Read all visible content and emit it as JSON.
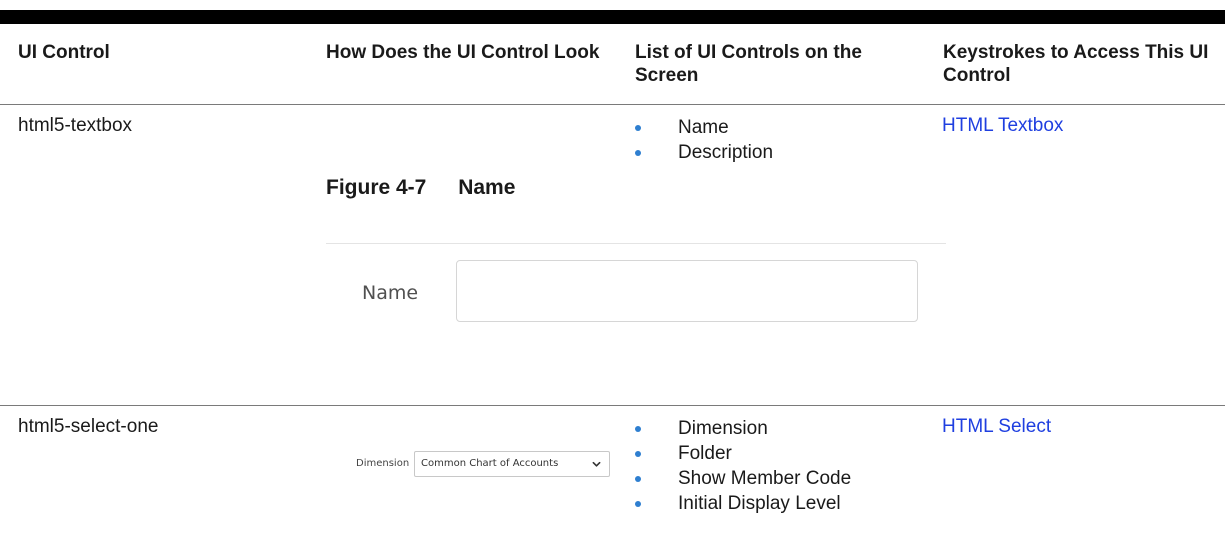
{
  "table": {
    "headers": [
      "UI Control",
      "How Does the UI Control Look",
      "List of UI Controls on the Screen",
      "Keystrokes to Access This UI Control"
    ],
    "rows": [
      {
        "control": "html5-textbox",
        "figure_number": "Figure 4-7",
        "figure_title": "Name",
        "mock_label": "Name",
        "mock_input_value": "",
        "list": [
          "Name",
          "Description"
        ],
        "keystroke_link": "HTML Textbox"
      },
      {
        "control": "html5-select-one",
        "mock_label": "Dimension",
        "mock_select_value": "Common Chart of Accounts",
        "list": [
          "Dimension",
          "Folder",
          "Show Member Code",
          "Initial Display Level"
        ],
        "keystroke_link": "HTML Select"
      }
    ]
  },
  "colors": {
    "link": "#1f3fe0",
    "bullet": "#2e7fd0",
    "header_rule": "#000000"
  },
  "icons": {
    "select_arrow": "chevron-down-icon",
    "bullet": "bullet-dot"
  }
}
